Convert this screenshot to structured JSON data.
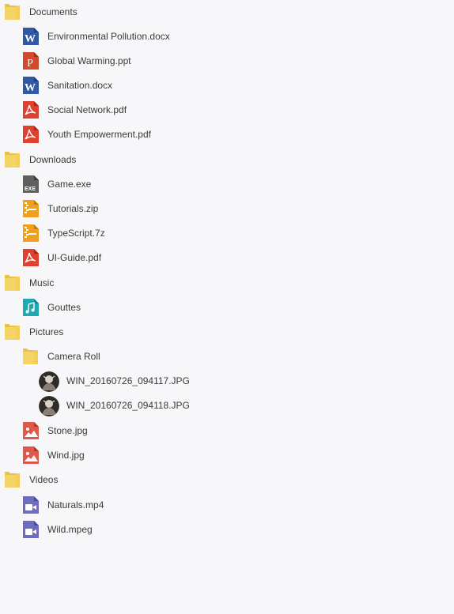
{
  "colors": {
    "background": "#f7f7f9",
    "folder": "#f3cf5a",
    "word": "#2f58a6",
    "powerpoint": "#d04a2b",
    "pdf": "#e0412f",
    "exe": "#5f5f5f",
    "zip": "#f0a020",
    "music": "#1eaab0",
    "image": "#e0584a",
    "video": "#6d6dc0"
  },
  "tree": [
    {
      "label": "Documents",
      "icon": "folder-icon"
    },
    {
      "label": "Environmental Pollution.docx",
      "icon": "word-file-icon"
    },
    {
      "label": "Global Warming.ppt",
      "icon": "powerpoint-file-icon"
    },
    {
      "label": "Sanitation.docx",
      "icon": "word-file-icon"
    },
    {
      "label": "Social Network.pdf",
      "icon": "pdf-file-icon"
    },
    {
      "label": "Youth Empowerment.pdf",
      "icon": "pdf-file-icon"
    },
    {
      "label": "Downloads",
      "icon": "folder-icon"
    },
    {
      "label": "Game.exe",
      "icon": "exe-file-icon"
    },
    {
      "label": "Tutorials.zip",
      "icon": "zip-file-icon"
    },
    {
      "label": "TypeScript.7z",
      "icon": "zip-file-icon"
    },
    {
      "label": "UI-Guide.pdf",
      "icon": "pdf-file-icon"
    },
    {
      "label": "Music",
      "icon": "folder-icon"
    },
    {
      "label": "Gouttes",
      "icon": "music-file-icon"
    },
    {
      "label": "Pictures",
      "icon": "folder-icon"
    },
    {
      "label": "Camera Roll",
      "icon": "folder-icon"
    },
    {
      "label": "WIN_20160726_094117.JPG",
      "icon": "photo-thumbnail"
    },
    {
      "label": "WIN_20160726_094118.JPG",
      "icon": "photo-thumbnail"
    },
    {
      "label": "Stone.jpg",
      "icon": "image-file-icon"
    },
    {
      "label": "Wind.jpg",
      "icon": "image-file-icon"
    },
    {
      "label": "Videos",
      "icon": "folder-icon"
    },
    {
      "label": "Naturals.mp4",
      "icon": "video-file-icon"
    },
    {
      "label": "Wild.mpeg",
      "icon": "video-file-icon"
    }
  ]
}
